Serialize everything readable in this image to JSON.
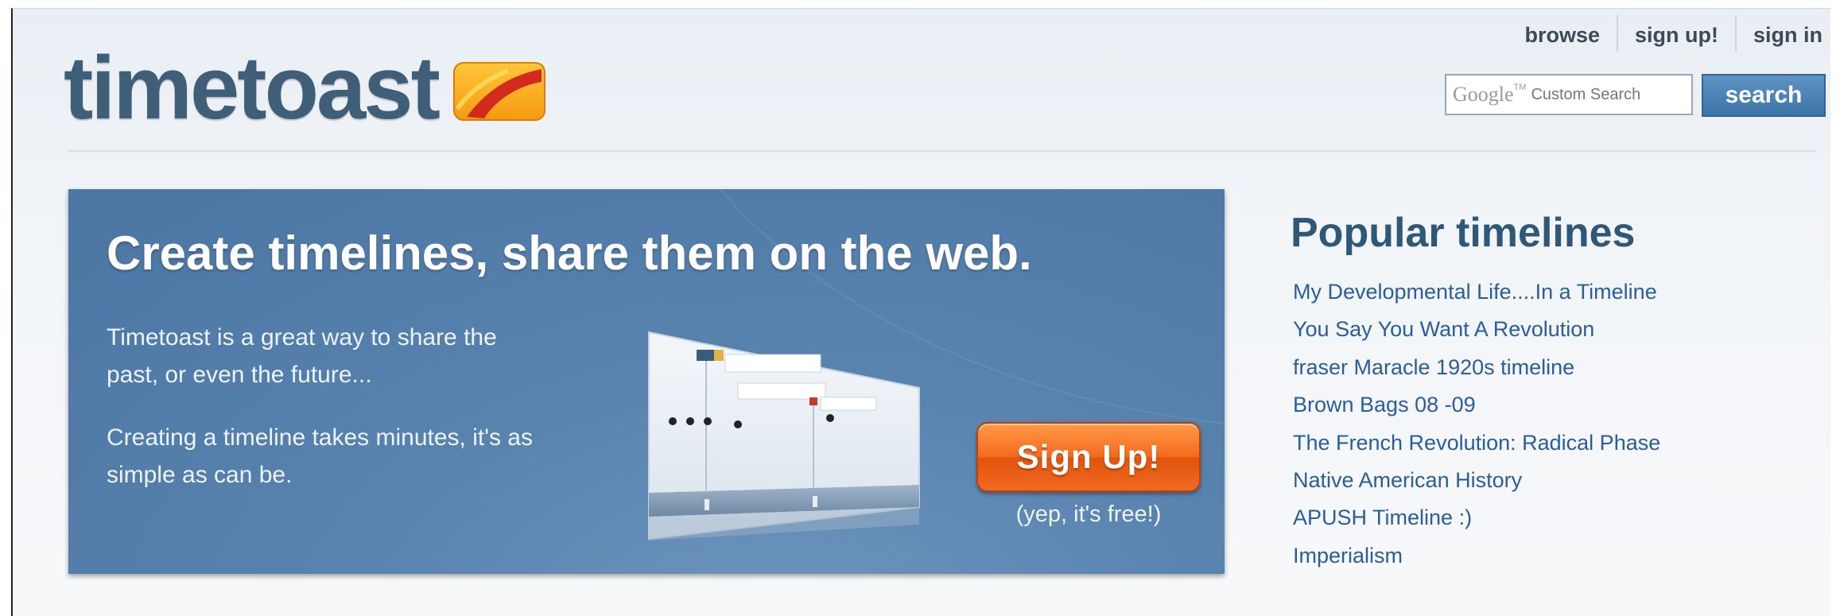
{
  "header": {
    "logo_text": "timetoast",
    "nav": [
      {
        "label": "browse"
      },
      {
        "label": "sign up!"
      },
      {
        "label": "sign in"
      }
    ],
    "search": {
      "brand": "Google",
      "brand_tm": "TM",
      "placeholder": "Custom Search",
      "button_label": "search"
    }
  },
  "hero": {
    "title": "Create timelines, share them on the web.",
    "paragraph1": "Timetoast is a great way to share the past, or even the future...",
    "paragraph2": "Creating a timeline takes minutes, it's as simple as can be.",
    "signup_label": "Sign Up!",
    "signup_note": "(yep, it's free!)"
  },
  "popular": {
    "title": "Popular timelines",
    "items": [
      "My Developmental Life....In a Timeline",
      "You Say You Want A Revolution",
      "fraser Maracle 1920s timeline",
      "Brown Bags 08 -09",
      "The French Revolution: Radical Phase",
      "Native American History",
      "APUSH Timeline :)",
      "Imperialism"
    ]
  },
  "colors": {
    "brand_blue": "#3f5f79",
    "hero_bg": "#5a84b0",
    "signup_orange": "#f46a1e",
    "link_blue": "#2a5d9a",
    "search_button": "#3d75a8"
  },
  "icons": [
    "timetoast-logo-icon",
    "timeline-preview-image"
  ]
}
